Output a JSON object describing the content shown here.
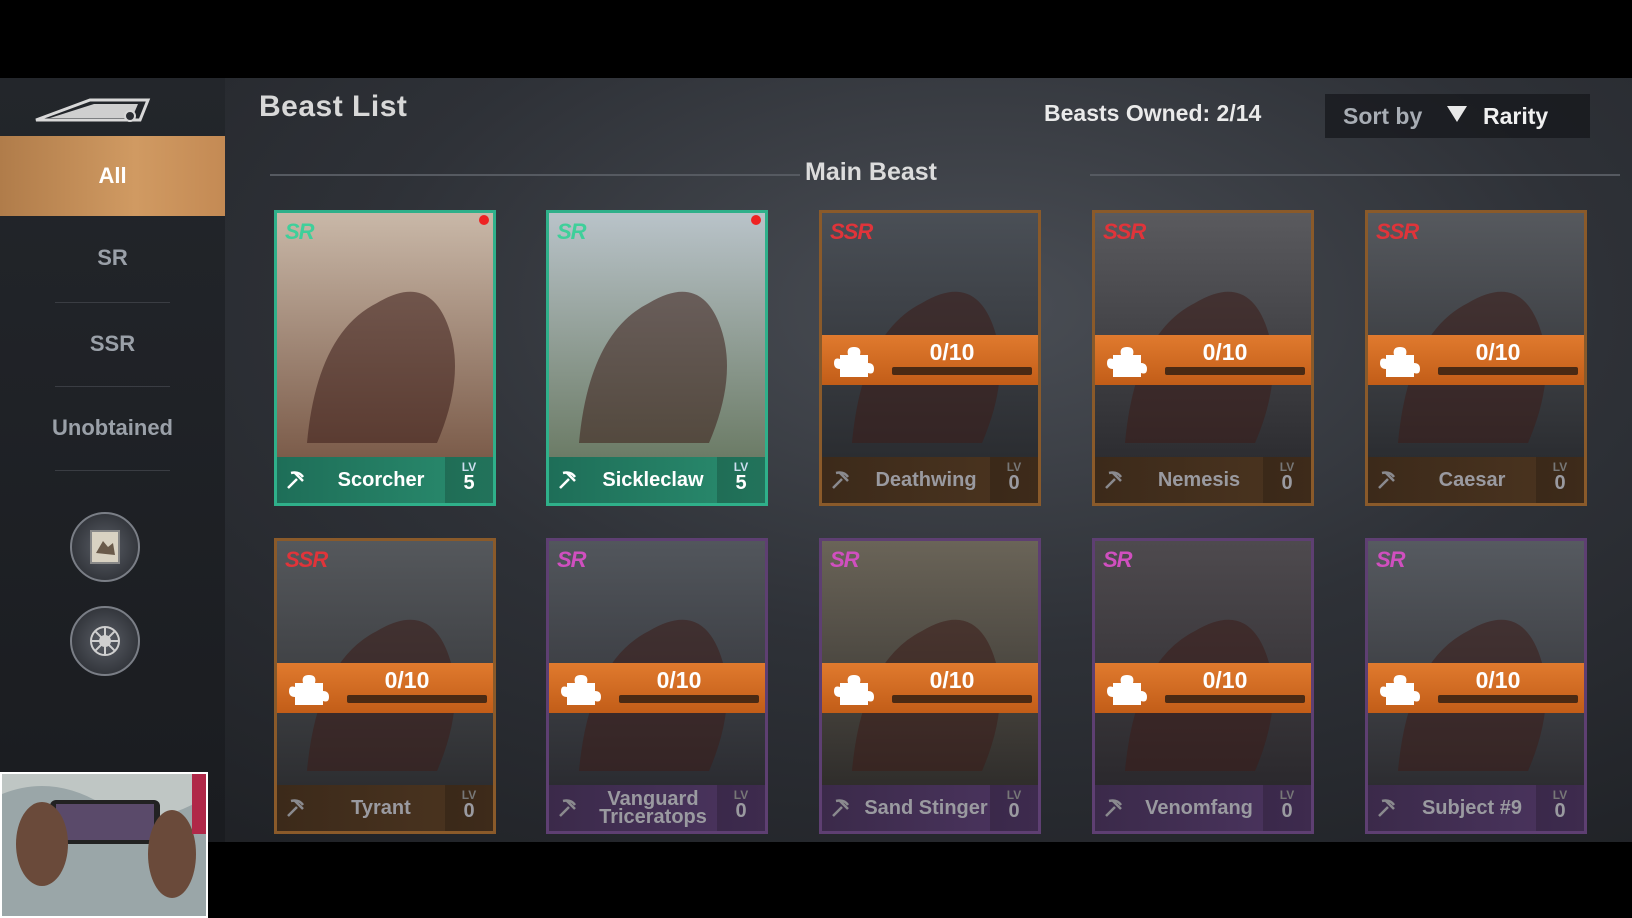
{
  "header": {
    "title": "Beast List",
    "owned_label": "Beasts Owned: 2/14",
    "sort_label": "Sort by",
    "sort_value": "Rarity",
    "section_title": "Main Beast"
  },
  "sidebar": {
    "tabs": [
      {
        "label": "All",
        "active": true
      },
      {
        "label": "SR",
        "active": false
      },
      {
        "label": "SSR",
        "active": false
      },
      {
        "label": "Unobtained",
        "active": false
      }
    ],
    "buttons": [
      {
        "icon": "beast-card-icon"
      },
      {
        "icon": "beast-emblem-icon"
      }
    ]
  },
  "beasts": [
    {
      "name": "Scorcher",
      "rarity": "SR",
      "owned": true,
      "level": "5",
      "lv_label": "LV",
      "fragments": null,
      "class_icon": "pickaxe-icon",
      "new": true
    },
    {
      "name": "Sickleclaw",
      "rarity": "SR",
      "owned": true,
      "level": "5",
      "lv_label": "LV",
      "fragments": null,
      "class_icon": "claw-icon",
      "new": true
    },
    {
      "name": "Deathwing",
      "rarity": "SSR",
      "owned": false,
      "level": "0",
      "lv_label": "LV",
      "fragments": "0/10",
      "progress": 0,
      "class_icon": "pickaxe-icon"
    },
    {
      "name": "Nemesis",
      "rarity": "SSR",
      "owned": false,
      "level": "0",
      "lv_label": "LV",
      "fragments": "0/10",
      "progress": 0,
      "class_icon": "shield-icon"
    },
    {
      "name": "Caesar",
      "rarity": "SSR",
      "owned": false,
      "level": "0",
      "lv_label": "LV",
      "fragments": "0/10",
      "progress": 0,
      "class_icon": "claw-icon"
    },
    {
      "name": "Tyrant",
      "rarity": "SSR",
      "owned": false,
      "level": "0",
      "lv_label": "LV",
      "fragments": "0/10",
      "progress": 0,
      "class_icon": "shield-icon"
    },
    {
      "name": "Vanguard Triceratops",
      "rarity": "SR",
      "owned": false,
      "level": "0",
      "lv_label": "LV",
      "fragments": "0/10",
      "progress": 0,
      "class_icon": "claw-icon"
    },
    {
      "name": "Sand Stinger",
      "rarity": "SR",
      "owned": false,
      "level": "0",
      "lv_label": "LV",
      "fragments": "0/10",
      "progress": 0,
      "class_icon": "shield-icon"
    },
    {
      "name": "Venomfang",
      "rarity": "SR",
      "owned": false,
      "level": "0",
      "lv_label": "LV",
      "fragments": "0/10",
      "progress": 0,
      "class_icon": "pickaxe-icon"
    },
    {
      "name": "Subject #9",
      "rarity": "SR",
      "owned": false,
      "level": "0",
      "lv_label": "LV",
      "fragments": "0/10",
      "progress": 0,
      "class_icon": "claw-icon"
    }
  ],
  "colors": {
    "accent_tab": "#c48a54",
    "sr_border": "#2fb08a",
    "ssr_border": "#8a5a2a",
    "fragment_bar": "#e07a2e"
  }
}
